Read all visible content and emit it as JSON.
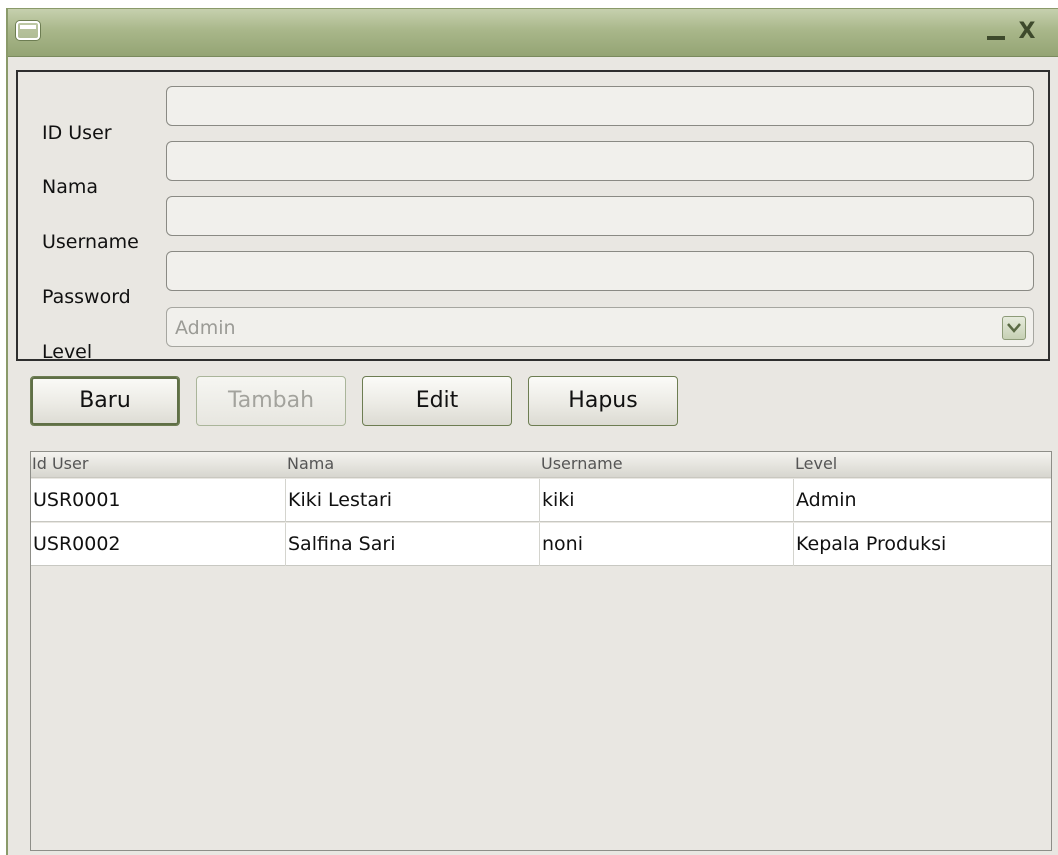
{
  "window": {
    "minimize_icon": "minimize-icon",
    "close_label": "X"
  },
  "form": {
    "fields": [
      {
        "label": "ID User",
        "value": ""
      },
      {
        "label": "Nama",
        "value": ""
      },
      {
        "label": "Username",
        "value": ""
      },
      {
        "label": "Password",
        "value": ""
      }
    ],
    "level": {
      "label": "Level",
      "selected": "Admin"
    }
  },
  "buttons": {
    "baru": "Baru",
    "tambah": "Tambah",
    "edit": "Edit",
    "hapus": "Hapus"
  },
  "table": {
    "columns": [
      "Id User",
      "Nama",
      "Username",
      "Level"
    ],
    "rows": [
      [
        "USR0001",
        "Kiki Lestari",
        "kiki",
        "Admin"
      ],
      [
        "USR0002",
        "Salfina Sari",
        "noni",
        "Kepala Produksi"
      ]
    ]
  },
  "colors": {
    "titlebar": "#a9b78a",
    "accent_border": "#6d7d52",
    "background": "#e9e7e2"
  }
}
